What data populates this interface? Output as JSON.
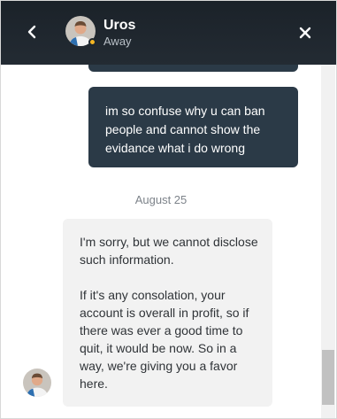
{
  "header": {
    "agent_name": "Uros",
    "agent_status": "Away"
  },
  "messages": {
    "outgoing_text": "im so confuse why u can ban people and cannot show the evidance what i do wrong",
    "date_separator": "August 25",
    "incoming_paragraphs": [
      "I'm sorry, but we cannot disclose such information.",
      "If it's any consolation, your account is overall in profit, so if there was ever a good time to quit, it would be now. So in a way, we're giving you a favor here."
    ]
  },
  "icons": {
    "back": "chevron-left-icon",
    "close": "close-icon",
    "status": "away-status-dot"
  },
  "colors": {
    "header_bg": "#1f272e",
    "outgoing_bubble": "#2b3a47",
    "incoming_bubble": "#f2f2f2",
    "away_status": "#f5b623"
  }
}
